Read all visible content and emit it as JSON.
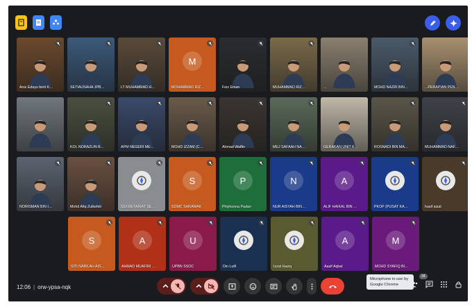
{
  "meeting": {
    "time": "12:06",
    "code": "orw-ypsa-nqk",
    "participant_count": "34"
  },
  "tooltip": "Microphone in use by Google Chrome",
  "colors": {
    "background": "#1a1b1e",
    "accent": "#3b5ee8",
    "end_call": "#ea4335"
  },
  "participants": [
    {
      "name": "Anis Edayu binti Ka...",
      "letter": "",
      "kind": "video",
      "bg": "#6b4a2e",
      "mic": "muted"
    },
    {
      "name": "SETIAUSAHA JPBB...",
      "letter": "",
      "kind": "video",
      "bg": "#3c5a7a",
      "mic": "muted"
    },
    {
      "name": "LT MUHAMMAD HA...",
      "letter": "",
      "kind": "video",
      "bg": "#5a4a3a",
      "mic": "muted"
    },
    {
      "name": "MOHAMMAD RIZAL ...",
      "letter": "M",
      "kind": "avatar",
      "bg": "#c65a1e",
      "mic": "muted"
    },
    {
      "name": "Feiz Eman",
      "letter": "",
      "kind": "video",
      "bg": "#2a2d30",
      "mic": "muted"
    },
    {
      "name": "MUHAMMAD RIZUL...",
      "letter": "",
      "kind": "video",
      "bg": "#7a6a4a",
      "mic": "muted"
    },
    {
      "name": "...",
      "letter": "",
      "kind": "video",
      "bg": "#8a8070",
      "mic": "none"
    },
    {
      "name": "MOHD NAZRI BIN A...",
      "letter": "",
      "kind": "video",
      "bg": "#4a5a6a",
      "mic": "muted"
    },
    {
      "name": "...PERAPIAN PENGU...",
      "letter": "",
      "kind": "video",
      "bg": "#a89070",
      "mic": "none"
    },
    {
      "name": "",
      "letter": "",
      "kind": "video",
      "bg": "#70777c",
      "mic": "none"
    },
    {
      "name": "KOL NORAZLIN BIN...",
      "letter": "",
      "kind": "video",
      "bg": "#4a5040",
      "mic": "muted"
    },
    {
      "name": "APM NEGERI MELAKA",
      "letter": "",
      "kind": "video",
      "bg": "#3a4a6a",
      "mic": "muted"
    },
    {
      "name": "MOHD IZZAM (COI...",
      "letter": "",
      "kind": "video",
      "bg": "#6a5a4a",
      "mic": "muted"
    },
    {
      "name": "Ahmad Waffin",
      "letter": "",
      "kind": "video",
      "bg": "#3a3530",
      "mic": "muted"
    },
    {
      "name": "MEJ SAFAAH NABIL...",
      "letter": "",
      "kind": "video",
      "bg": "#5a6a5a",
      "mic": "muted"
    },
    {
      "name": "GERAKAN UNIT KES...",
      "letter": "",
      "kind": "video",
      "bg": "#c0b8a8",
      "mic": "none"
    },
    {
      "name": "ROSNADI BIN MAT...",
      "letter": "",
      "kind": "video",
      "bg": "#5a5548",
      "mic": "muted"
    },
    {
      "name": "MUHAMMAD NAFIZ...",
      "letter": "",
      "kind": "video",
      "bg": "#3e4248",
      "mic": "muted"
    },
    {
      "name": "NORISMAN BIN IDRI...",
      "letter": "",
      "kind": "video",
      "bg": "#5c6470",
      "mic": "muted"
    },
    {
      "name": "Mohd Afiq Zulkefeli",
      "letter": "",
      "kind": "video",
      "bg": "#6a5040",
      "mic": "muted"
    },
    {
      "name": "SEKRETARIAT SELA...",
      "letter": "",
      "kind": "logo",
      "bg": "#8a8d90",
      "mic": "muted"
    },
    {
      "name": "SDMC SARAWAK",
      "letter": "S",
      "kind": "avatar",
      "bg": "#c65a1e",
      "mic": "muted"
    },
    {
      "name": "Phiyhonna Padan",
      "letter": "P",
      "kind": "avatar",
      "bg": "#1e6e3a",
      "mic": "muted"
    },
    {
      "name": "NUR AISYAH BINTI ...",
      "letter": "N",
      "kind": "avatar",
      "bg": "#1a3a8a",
      "mic": "muted"
    },
    {
      "name": "ALIF HAIKAL BIN RO...",
      "letter": "A",
      "kind": "avatar",
      "bg": "#5a1a8a",
      "mic": "muted"
    },
    {
      "name": "PKOP (PUSAT KAWA...",
      "letter": "",
      "kind": "logo",
      "bg": "#1a3a8a",
      "mic": "muted"
    },
    {
      "name": "hasif aizat",
      "letter": "",
      "kind": "logo",
      "bg": "#4a3a2a",
      "mic": "muted"
    },
    {
      "name": "SITI NABILAH AISYA...",
      "letter": "S",
      "kind": "avatar",
      "bg": "#c65a1e",
      "mic": "muted"
    },
    {
      "name": "AHMAD MUAFIRI BI...",
      "letter": "A",
      "kind": "avatar",
      "bg": "#b03018",
      "mic": "muted"
    },
    {
      "name": "UPBN SSOC",
      "letter": "U",
      "kind": "avatar",
      "bg": "#8a1a4a",
      "mic": "muted"
    },
    {
      "name": "Din Lutfi",
      "letter": "",
      "kind": "logo",
      "bg": "#1a3050",
      "mic": "muted"
    },
    {
      "name": "Izzat Haziq",
      "letter": "",
      "kind": "logo",
      "bg": "#5a5a30",
      "mic": "muted"
    },
    {
      "name": "Aasif Aqbal",
      "letter": "A",
      "kind": "avatar",
      "bg": "#5a1a8a",
      "mic": "muted"
    },
    {
      "name": "MOHD SYAFIQ BIN ...",
      "letter": "M",
      "kind": "avatar",
      "bg": "#6a1a7a",
      "mic": "muted"
    }
  ]
}
